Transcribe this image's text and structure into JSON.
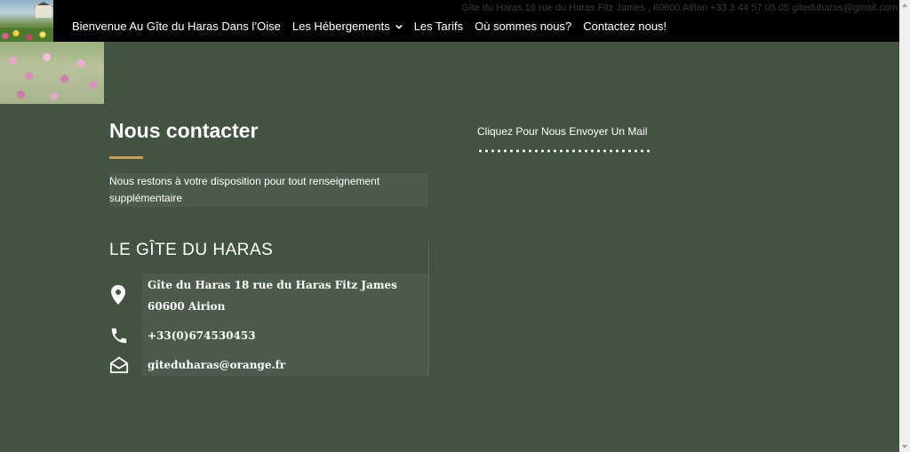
{
  "header": {
    "top_contact_line": "Gîte du Haras 18 rue du Haras Fitz James , 60600 Airion +33 3 44 57 05 05 giteduharas@gmail.com",
    "nav": [
      {
        "label": "Bienvenue Au Gîte du Haras Dans l’Oise"
      },
      {
        "label": "Les Hébergements",
        "has_dropdown": true
      },
      {
        "label": "Les Tarifs"
      },
      {
        "label": "Où sommes nous?"
      },
      {
        "label": "Contactez nous!"
      }
    ]
  },
  "main": {
    "title": "Nous contacter",
    "intro": "Nous restons à votre disposition pour tout renseignement supplémentaire",
    "mail_link": "Cliquez Pour Nous Envoyer Un Mail"
  },
  "gite": {
    "title": "LE GÎTE DU HARAS",
    "address_line1": "Gîte du Haras 18 rue du Haras Fitz James",
    "address_line2": "60600 Airion",
    "phone": "+33(0)674530453",
    "email": "giteduharas@orange.fr"
  },
  "colors": {
    "background": "#435342",
    "accent": "#c79c58",
    "topbar": "#000000"
  }
}
